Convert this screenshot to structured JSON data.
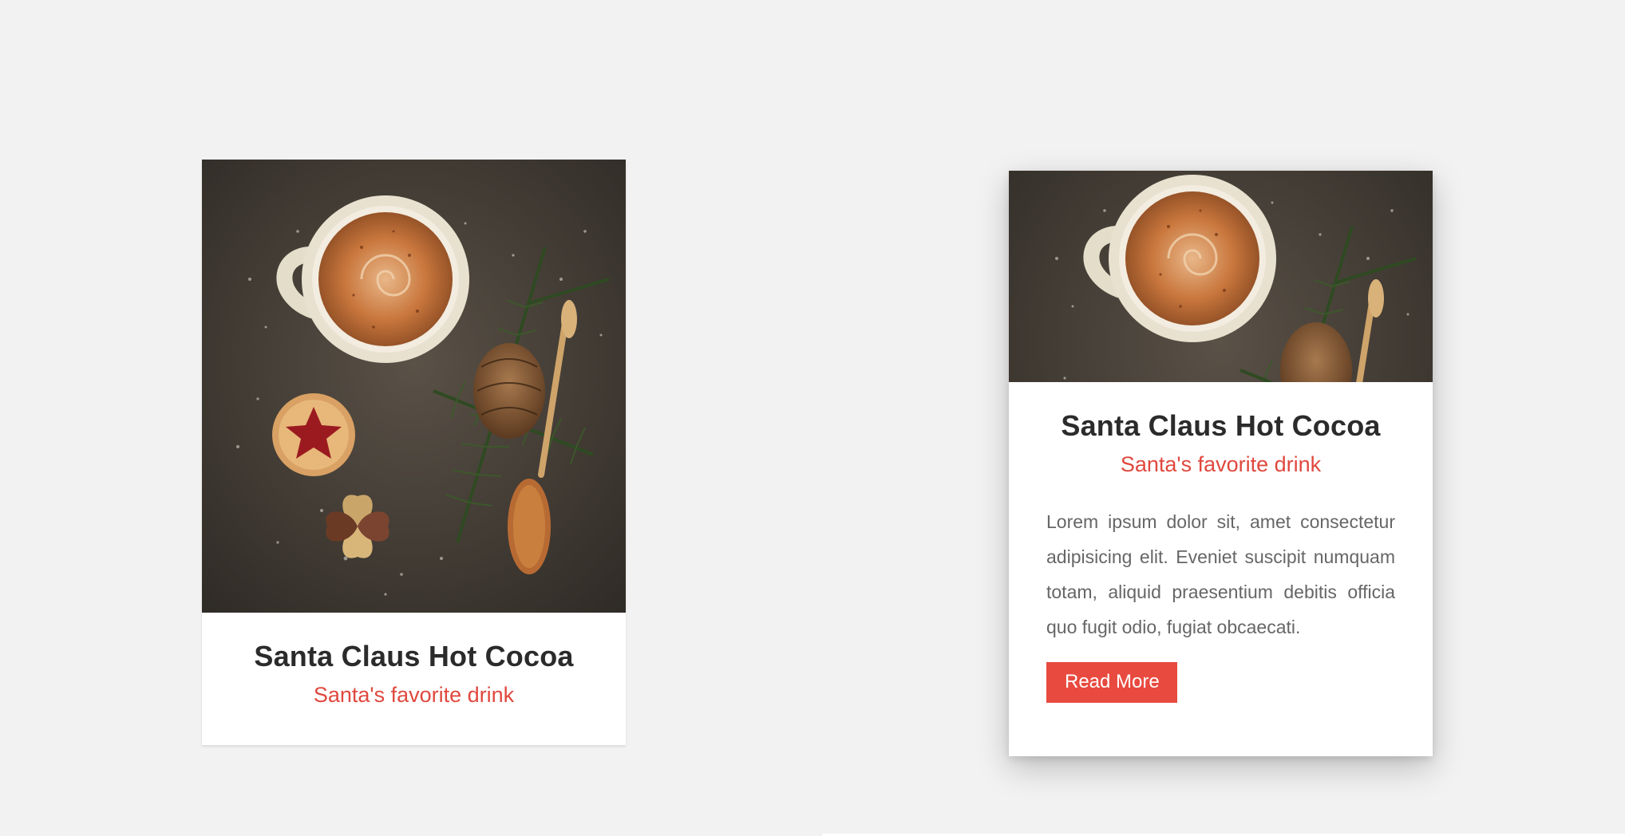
{
  "cards": [
    {
      "image_alt": "Hot cocoa with cookies and pine branches",
      "title": "Santa Claus Hot Cocoa",
      "subtitle": "Santa's favorite drink"
    },
    {
      "image_alt": "Hot cocoa with cookies and pine branches",
      "title": "Santa Claus Hot Cocoa",
      "subtitle": "Santa's favorite drink",
      "description": "Lorem ipsum dolor sit, amet consectetur adipisicing elit. Eveniet suscipit numquam totam, aliquid praesentium debitis officia quo fugit odio, fugiat obcaecati.",
      "button_label": "Read More"
    }
  ],
  "colors": {
    "accent": "#e84a3f",
    "subtitle": "#e0483e",
    "title": "#2b2b2b",
    "body_text": "#666666",
    "background": "#f2f2f2"
  }
}
